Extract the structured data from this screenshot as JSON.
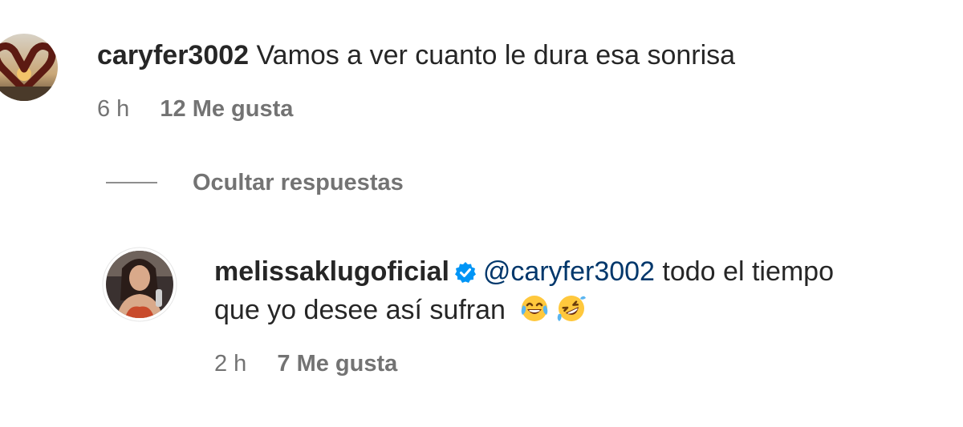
{
  "comments": [
    {
      "username": "caryfer3002",
      "text": "Vamos a ver cuanto le dura esa sonrisa",
      "time": "6 h",
      "likes": "12 Me gusta",
      "avatar_icon": "heart-hands-sunset-avatar"
    }
  ],
  "hide_replies_label": "Ocultar respuestas",
  "reply": {
    "username": "melissaklugoficial",
    "verified": true,
    "verified_color": "#0095f6",
    "mention": "@caryfer3002",
    "text_line1": "todo el tiempo",
    "text_line2": "que yo desee así sufran",
    "emojis": [
      "face-with-tears-of-joy-emoji",
      "rolling-on-floor-laughing-emoji"
    ],
    "time": "2 h",
    "likes": "7 Me gusta",
    "avatar_icon": "woman-portrait-avatar"
  },
  "colors": {
    "text_primary": "#262626",
    "text_secondary": "#737373",
    "mention": "#00376b"
  }
}
